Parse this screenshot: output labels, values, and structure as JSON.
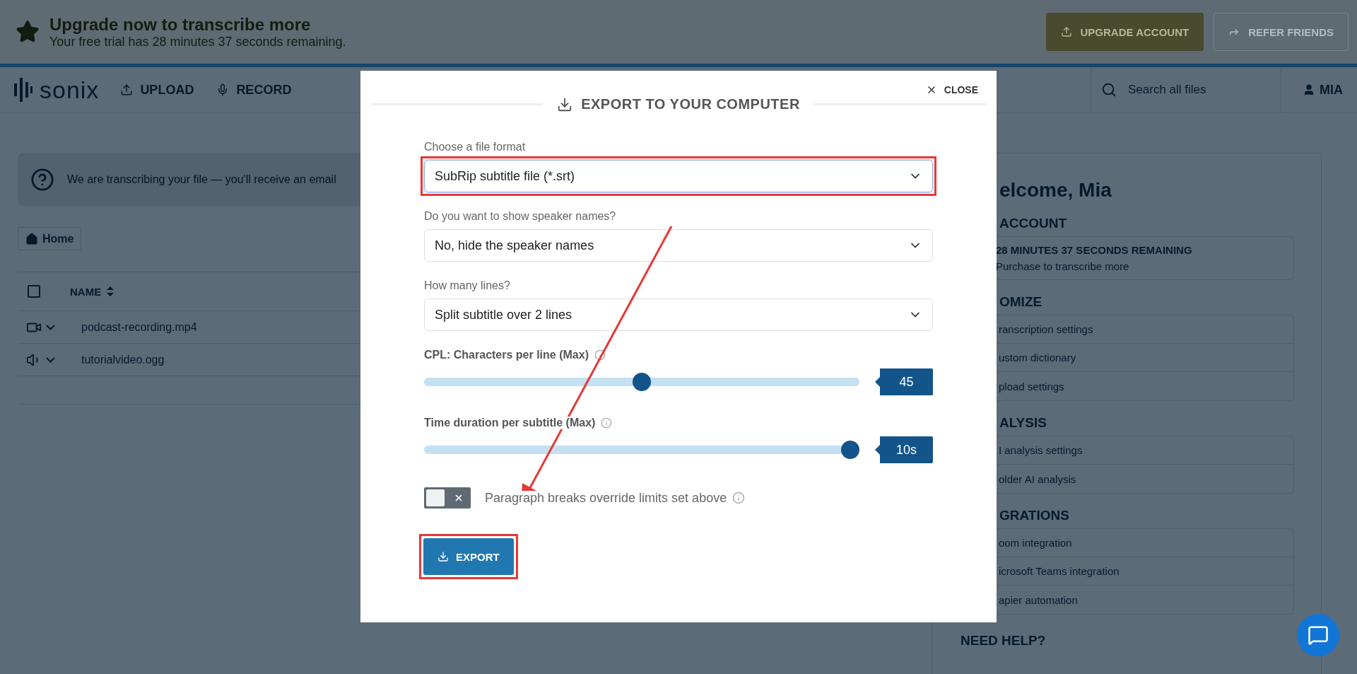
{
  "banner": {
    "title": "Upgrade now to transcribe more",
    "subtitle": "Your free trial has 28 minutes 37 seconds remaining.",
    "buttons": [
      {
        "kind": "upgrade",
        "label": "UPGRADE ACCOUNT"
      },
      {
        "kind": "refer",
        "label": "REFER FRIENDS"
      }
    ]
  },
  "nav": {
    "logo": "sonix",
    "links": [
      {
        "kind": "upload",
        "label": "UPLOAD"
      },
      {
        "kind": "record",
        "label": "RECORD"
      }
    ],
    "search": {
      "placeholder": "Search all files"
    },
    "user": "MIA"
  },
  "notice": "We are transcribing your file — you'll receive an email",
  "breadcrumb": "Home",
  "table": {
    "header_checked": false,
    "columns": [
      "NAME"
    ],
    "rows": [
      {
        "kind": "video",
        "name": "podcast-recording.mp4"
      },
      {
        "kind": "audio",
        "name": "tutorialvideo.ogg"
      }
    ]
  },
  "right_panel": {
    "greeting": "elcome, Mia",
    "sections": [
      {
        "heading": "ACCOUNT",
        "card": {
          "title": "28 MINUTES 37 SECONDS REMAINING",
          "subtitle": "Purchase to transcribe more"
        }
      },
      {
        "heading": "OMIZE",
        "items": [
          "ranscription settings",
          "ustom dictionary",
          "pload settings"
        ]
      },
      {
        "heading": "ALYSIS",
        "items": [
          "I analysis settings",
          "older AI analysis"
        ]
      },
      {
        "heading": "GRATIONS",
        "items": [
          "oom integration",
          "icrosoft Teams integration",
          "apier automation"
        ]
      },
      {
        "heading": "NEED HELP?"
      }
    ]
  },
  "modal": {
    "title": "EXPORT TO YOUR COMPUTER",
    "close": "CLOSE",
    "selects": [
      {
        "label": "Choose a file format",
        "value": "SubRip subtitle file (*.srt)",
        "highlighted": true
      },
      {
        "label": "Do you want to show speaker names?",
        "value": "No, hide the speaker names",
        "highlighted": false
      },
      {
        "label": "How many lines?",
        "value": "Split subtitle over 2 lines",
        "highlighted": false
      }
    ],
    "sliders": [
      {
        "label": "CPL: Characters per line (Max)",
        "level": 0.5,
        "reading": "45"
      },
      {
        "label": "Time duration per subtitle (Max)",
        "level": 1,
        "reading": "10s"
      }
    ],
    "toggle": {
      "label": "Paragraph breaks override limits set above",
      "on": false
    },
    "button": {
      "label": "EXPORT",
      "highlighted": true
    }
  }
}
